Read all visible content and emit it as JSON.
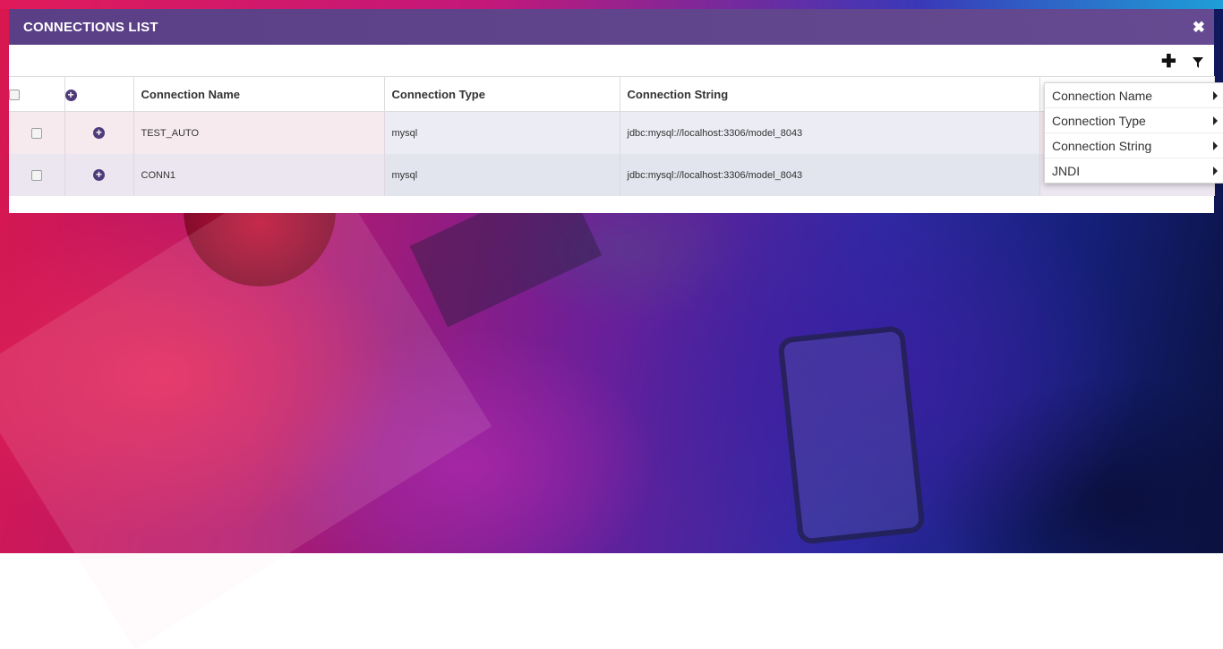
{
  "dialog": {
    "title": "CONNECTIONS LIST",
    "close_icon": "close-icon"
  },
  "toolbar": {
    "add_icon": "plus-icon",
    "filter_icon": "filter-icon"
  },
  "table": {
    "columns": [
      "",
      "",
      "Connection Name",
      "Connection Type",
      "Connection String",
      ""
    ],
    "rows": [
      {
        "name": "TEST_AUTO",
        "type": "mysql",
        "connection_string": "jdbc:mysql://localhost:3306/model_8043",
        "jndi": ""
      },
      {
        "name": "CONN1",
        "type": "mysql",
        "connection_string": "jdbc:mysql://localhost:3306/model_8043",
        "jndi": "--"
      }
    ]
  },
  "filter_menu": {
    "items": [
      {
        "label": "Connection Name"
      },
      {
        "label": "Connection Type"
      },
      {
        "label": "Connection String"
      },
      {
        "label": "JNDI"
      }
    ]
  },
  "colors": {
    "header": "#5a3f86",
    "accent": "#4e3b7a"
  }
}
